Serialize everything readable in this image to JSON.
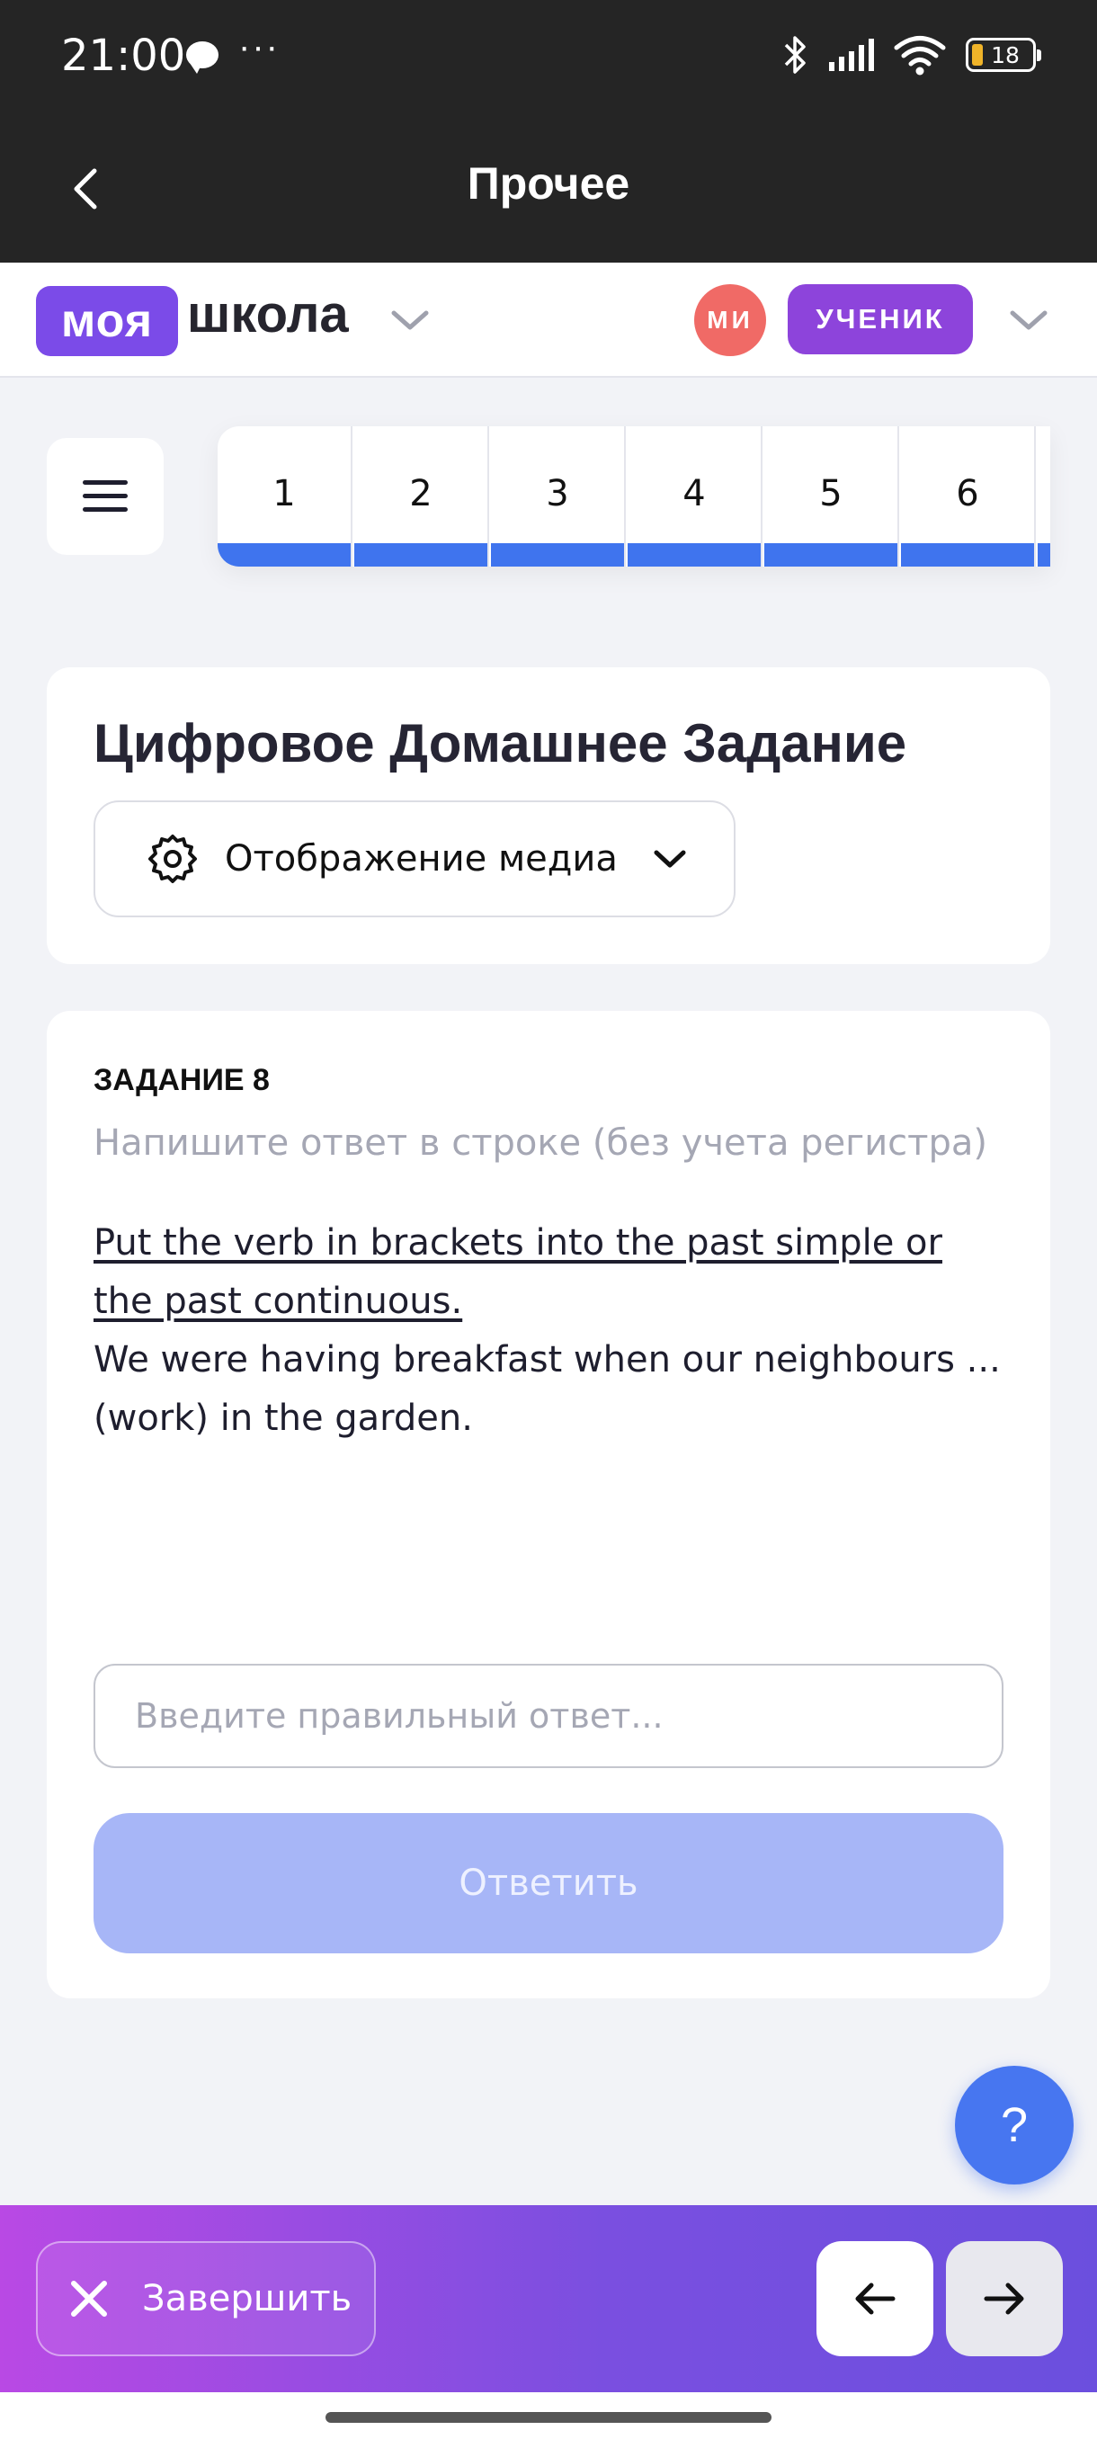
{
  "status_bar": {
    "time": "21:00",
    "dots": "···",
    "battery": "18"
  },
  "app_bar": {
    "title": "Прочее"
  },
  "school_header": {
    "logo_part1": "моя",
    "logo_part2": "школа",
    "avatar_initials": "МИ",
    "role": "УЧЕНИК"
  },
  "question_nav": {
    "items": [
      "1",
      "2",
      "3",
      "4",
      "5",
      "6"
    ]
  },
  "homework_card": {
    "title": "Цифровое Домашнее Задание",
    "media_label": "Отображение медиа"
  },
  "task": {
    "number_label": "ЗАДАНИЕ 8",
    "hint": "Напишите ответ в строке (без учета регистра)",
    "instruction": "Put the verb in brackets into the past simple or the past continuous.",
    "sentence": "We were having breakfast when our neighbours ... (work) in the garden.",
    "answer_placeholder": "Введите правильный ответ...",
    "answer_value": "",
    "submit_label": "Ответить"
  },
  "help": {
    "label": "?"
  },
  "bottom_bar": {
    "finish_label": "Завершить"
  },
  "colors": {
    "accent_purple": "#7b4be8",
    "accent_blue": "#3f74ee",
    "submit_disabled": "#a7b6f7",
    "avatar_red": "#f06a66"
  }
}
